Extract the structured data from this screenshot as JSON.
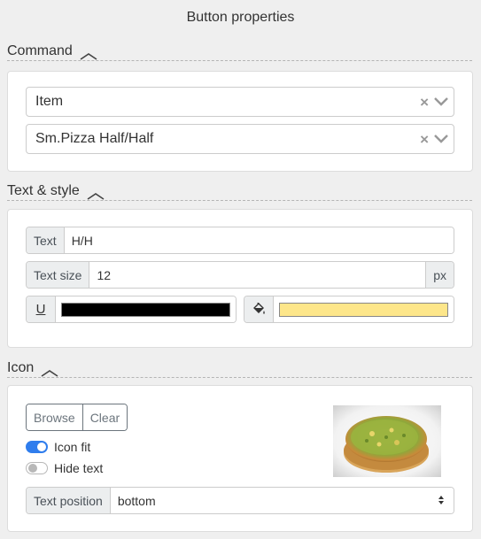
{
  "header": {
    "title": "Button properties"
  },
  "command": {
    "section_label": "Command",
    "type_value": "Item",
    "item_value": "Sm.Pizza Half/Half"
  },
  "text_style": {
    "section_label": "Text & style",
    "text_label": "Text",
    "text_value": "H/H",
    "size_label": "Text size",
    "size_value": "12",
    "size_unit": "px",
    "underline_label": "U",
    "text_color": "#000000",
    "fill_color": "#fde68a"
  },
  "icon": {
    "section_label": "Icon",
    "browse_label": "Browse",
    "clear_label": "Clear",
    "icon_fit_label": "Icon fit",
    "icon_fit_on": true,
    "hide_text_label": "Hide text",
    "hide_text_on": false,
    "position_label": "Text position",
    "position_value": "bottom",
    "image": "pizza-photo"
  },
  "colors": {
    "accent": "#2f7ded",
    "panel_border": "#dcdcdc",
    "background": "#efefef"
  }
}
